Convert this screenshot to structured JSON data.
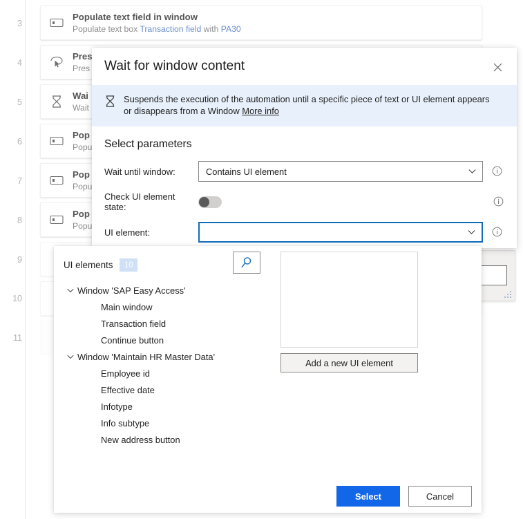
{
  "flow": {
    "rows": [
      {
        "num": "3",
        "icon": "textbox-icon",
        "title": "Populate text field in window",
        "sub_pre": "Populate text box ",
        "sub_link1": "Transaction field",
        "sub_mid": " with ",
        "sub_link2": "PA30",
        "sub_post": "",
        "state": "normal"
      },
      {
        "num": "4",
        "icon": "press-button-icon",
        "title": "Pres",
        "sub_pre": "Pres",
        "sub_link1": "",
        "sub_mid": "",
        "sub_link2": "",
        "sub_post": "",
        "state": "normal"
      },
      {
        "num": "5",
        "icon": "hourglass-icon",
        "title": "Wai",
        "sub_pre": "Wait",
        "sub_link1": "",
        "sub_mid": "",
        "sub_link2": "",
        "sub_post": "",
        "state": "normal"
      },
      {
        "num": "6",
        "icon": "textbox-icon",
        "title": "Pop",
        "sub_pre": "Popu",
        "sub_link1": "",
        "sub_mid": "",
        "sub_link2": "",
        "sub_post": "",
        "state": "normal"
      },
      {
        "num": "7",
        "icon": "textbox-icon",
        "title": "Pop",
        "sub_pre": "Popu",
        "sub_link1": "",
        "sub_mid": "",
        "sub_link2": "",
        "sub_post": "",
        "state": "normal"
      },
      {
        "num": "8",
        "icon": "textbox-icon",
        "title": "Pop",
        "sub_pre": "Popu",
        "sub_link1": "",
        "sub_mid": "",
        "sub_link2": "",
        "sub_post": "",
        "state": "normal"
      },
      {
        "num": "9",
        "icon": "",
        "title": "",
        "sub_pre": "",
        "sub_link1": "",
        "sub_mid": "",
        "sub_link2": "",
        "sub_post": "",
        "state": "hidden"
      },
      {
        "num": "10",
        "icon": "",
        "title": "",
        "sub_pre": "",
        "sub_link1": "",
        "sub_mid": "",
        "sub_link2": "",
        "sub_post": "",
        "state": "hidden"
      },
      {
        "num": "11",
        "icon": "",
        "title": "",
        "sub_pre": "",
        "sub_link1": "",
        "sub_mid": "",
        "sub_link2": "",
        "sub_post": "",
        "state": "hidden"
      }
    ]
  },
  "modal": {
    "title": "Wait for window content",
    "close_icon": "close-icon",
    "banner": {
      "icon": "hourglass-icon",
      "text": "Suspends the execution of the automation until a specific piece of text or UI element appears or disappears from a Window ",
      "link_label": "More info"
    },
    "section_title": "Select parameters",
    "params": {
      "wait_until_label": "Wait until window:",
      "wait_until_value": "Contains UI element",
      "check_state_label": "Check UI element state:",
      "check_state_on": false,
      "ui_element_label": "UI element:",
      "ui_element_value": "",
      "info_icon": "info-icon",
      "chevron_icon": "chevron-down-icon"
    }
  },
  "picker": {
    "header_label": "UI elements",
    "count": "10",
    "search_icon": "search-icon",
    "add_button_label": "Add a new UI element",
    "tree": [
      {
        "label": "Window 'SAP Easy Access'",
        "children": [
          "Main window",
          "Transaction field",
          "Continue button"
        ]
      },
      {
        "label": "Window 'Maintain HR Master Data'",
        "children": [
          "Employee id",
          "Effective date",
          "Infotype",
          "Info subtype",
          "New address button"
        ]
      }
    ],
    "select_label": "Select",
    "cancel_label": "Cancel"
  },
  "colors": {
    "accent": "#1267e8",
    "banner_bg": "#e8f1fb",
    "badge_bg": "#cfe0f7",
    "focus_border": "#0f6cbd",
    "link": "#6b8ec9"
  }
}
